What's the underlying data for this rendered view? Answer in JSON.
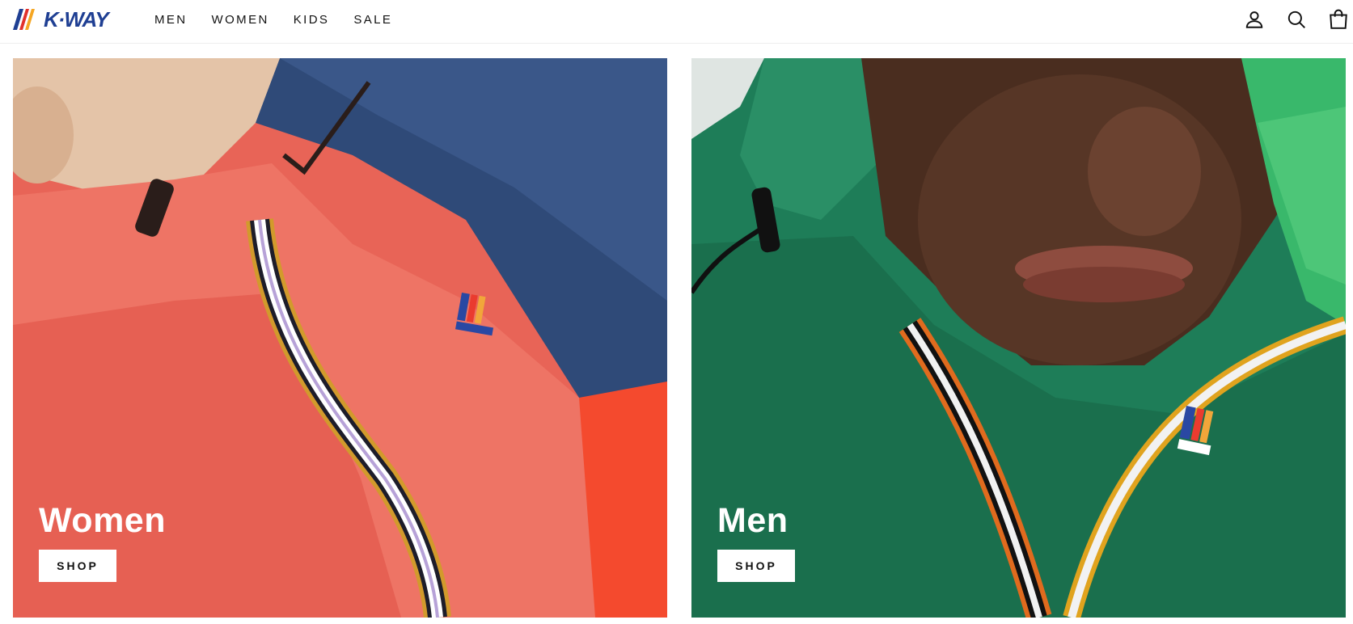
{
  "brand": {
    "name": "K·WAY",
    "logo_colors": [
      "#1f3f93",
      "#e2312b",
      "#f5a623"
    ]
  },
  "nav": {
    "items": [
      {
        "label": "MEN"
      },
      {
        "label": "WOMEN"
      },
      {
        "label": "KIDS"
      },
      {
        "label": "SALE"
      }
    ]
  },
  "header_icons": [
    "account-icon",
    "search-icon",
    "cart-icon"
  ],
  "panels": {
    "women": {
      "title": "Women",
      "button": "SHOP",
      "jacket_color": "#e86457"
    },
    "men": {
      "title": "Men",
      "button": "SHOP",
      "jacket_color": "#1e7d58"
    }
  }
}
